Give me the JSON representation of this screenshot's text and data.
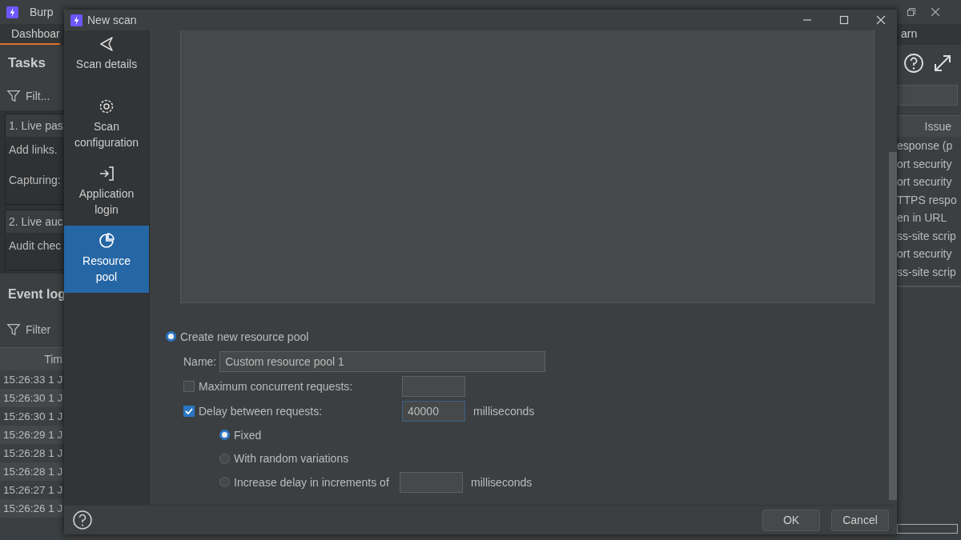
{
  "main_window": {
    "title": "Burp",
    "tabs": [
      {
        "label": "Dashboar",
        "selected": true
      },
      {
        "label": "arn",
        "selected": false
      }
    ],
    "tasks": {
      "title": "Tasks",
      "filter": "Filt...",
      "items": [
        {
          "title": "1. Live pas",
          "lines": [
            "Add links. ",
            "Capturing:"
          ]
        },
        {
          "title": "2. Live auc",
          "lines": [
            "Audit chec"
          ]
        }
      ]
    },
    "event_log": {
      "title": "Event log",
      "filter": "Filter",
      "columns": [
        "Tim"
      ],
      "rows": [
        "15:26:33 1 J",
        "15:26:30 1 J",
        "15:26:30 1 J",
        "15:26:29 1 J",
        "15:26:28 1 J",
        "15:26:28 1 J",
        "15:26:27 1 J",
        "15:26:26 1 J"
      ]
    },
    "issues": {
      "columns": [
        "Issue"
      ],
      "rows": [
        "esponse (p",
        "ort security",
        "ort security",
        "TTPS respo",
        "en in URL",
        "ss-site scrip",
        "ort security",
        "ss-site scrip"
      ]
    }
  },
  "dialog": {
    "title": "New scan",
    "nav": [
      {
        "label": "Scan details",
        "kind": "details",
        "selected": false
      },
      {
        "label": "Scan configuration",
        "kind": "config",
        "selected": false
      },
      {
        "label": "Application login",
        "kind": "login",
        "selected": false
      },
      {
        "label": "Resource pool",
        "kind": "pool",
        "selected": true
      }
    ],
    "resource_pool": {
      "create_new": {
        "label": "Create new resource pool",
        "selected": true
      },
      "name": {
        "label": "Name:",
        "value": "Custom resource pool 1"
      },
      "max_concurrent": {
        "label": "Maximum concurrent requests:",
        "checked": false
      },
      "delay": {
        "label": "Delay between requests:",
        "checked": true,
        "value": "40000",
        "unit": "milliseconds"
      },
      "delay_modes": [
        {
          "label": "Fixed",
          "selected": true
        },
        {
          "label": "With random variations",
          "selected": false
        },
        {
          "label": "Increase delay in increments of",
          "selected": false,
          "unit": "milliseconds"
        }
      ]
    },
    "buttons": [
      {
        "label": "OK"
      },
      {
        "label": "Cancel"
      }
    ]
  }
}
